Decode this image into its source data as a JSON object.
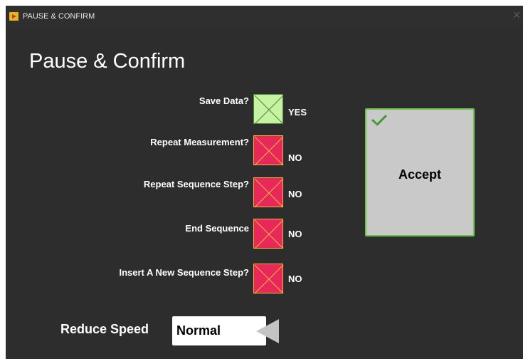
{
  "window": {
    "title": "PAUSE & CONFIRM",
    "close_glyph": "✕"
  },
  "main": {
    "heading": "Pause & Confirm"
  },
  "options": [
    {
      "label": "Save Data?",
      "state": "YES",
      "checked": true
    },
    {
      "label": "Repeat Measurement?",
      "state": "NO",
      "checked": false
    },
    {
      "label": "Repeat Sequence Step?",
      "state": "NO",
      "checked": false
    },
    {
      "label": "End Sequence",
      "state": "NO",
      "checked": false
    },
    {
      "label": "Insert A New Sequence Step?",
      "state": "NO",
      "checked": false
    }
  ],
  "accept": {
    "label": "Accept",
    "icon": "checkmark-icon"
  },
  "speed": {
    "label": "Reduce Speed",
    "value": "Normal",
    "icon": "triangle-left-icon"
  },
  "colors": {
    "background": "#2d2d2d",
    "yes_fill": "#c6f2a2",
    "no_fill": "#e8285a",
    "accept_fill": "#c9c9c9",
    "accept_border": "#6bc24a"
  }
}
